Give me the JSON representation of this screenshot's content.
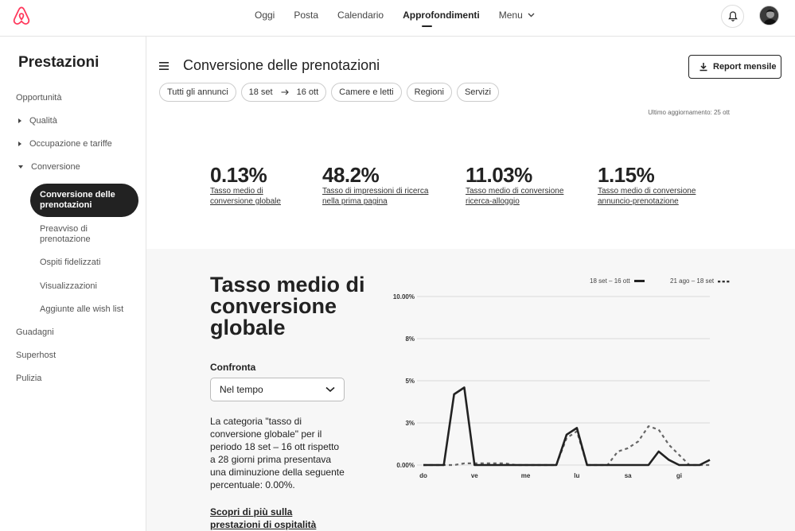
{
  "brand": {
    "accent": "#FF385C"
  },
  "topnav": {
    "items": [
      {
        "label": "Oggi"
      },
      {
        "label": "Posta"
      },
      {
        "label": "Calendario"
      },
      {
        "label": "Approfondimenti",
        "active": true
      },
      {
        "label": "Menu"
      }
    ]
  },
  "sidebar": {
    "title": "Prestazioni",
    "opportunita": "Opportunità",
    "qualita": "Qualità",
    "occupazione": "Occupazione e tariffe",
    "conversione": "Conversione",
    "sub": {
      "conv_prenotazioni": "Conversione delle prenotazioni",
      "preavviso": "Preavviso di prenotazione",
      "ospiti": "Ospiti fidelizzati",
      "visualizzazioni": "Visualizzazioni",
      "wishlist": "Aggiunte alle wish list"
    },
    "guadagni": "Guadagni",
    "superhost": "Superhost",
    "pulizia": "Pulizia"
  },
  "main": {
    "title": "Conversione delle prenotazioni",
    "report_button": "Report mensile",
    "filters": {
      "listings": "Tutti gli annunci",
      "date_from": "18 set",
      "date_to": "16 ott",
      "rooms": "Camere e letti",
      "regions": "Regioni",
      "services": "Servizi"
    },
    "updated": "Ultimo aggiornamento: 25 ott",
    "stats": [
      {
        "value": "0.13%",
        "label": "Tasso medio di conversione globale"
      },
      {
        "value": "48.2%",
        "label": "Tasso di impressioni di ricerca nella prima pagina"
      },
      {
        "value": "11.03%",
        "label": "Tasso medio di conversione ricerca-alloggio"
      },
      {
        "value": "1.15%",
        "label": "Tasso medio di conversione annuncio-prenotazione"
      }
    ]
  },
  "detail": {
    "title": "Tasso medio di conversione globale",
    "compare_label": "Confronta",
    "compare_value": "Nel tempo",
    "description": "La categoria \"tasso di conversione globale\" per il periodo 18 set – 16 ott rispetto a 28 giorni prima presentava una diminuzione della seguente percentuale: 0.00%.",
    "learn_more": "Scopri di più sulla prestazioni di ospitalità"
  },
  "chart_data": {
    "type": "line",
    "y_tick_labels": [
      "0.00%",
      "3%",
      "5%",
      "8%",
      "10.00%"
    ],
    "y_tick_values": [
      0,
      2.5,
      5,
      7.5,
      10
    ],
    "ylim": [
      0,
      10
    ],
    "x_tick_labels": [
      "do",
      "ve",
      "me",
      "lu",
      "sa",
      "gi"
    ],
    "x_tick_index": [
      0,
      5,
      10,
      15,
      20,
      25
    ],
    "grid": true,
    "legend_placement": "top-right",
    "series": [
      {
        "name": "18 set – 16 ott",
        "style": "solid",
        "color": "#222222",
        "values": [
          0,
          0,
          0,
          4.2,
          4.6,
          0,
          0,
          0,
          0,
          0,
          0,
          0,
          0,
          0,
          1.8,
          2.2,
          0,
          0,
          0,
          0,
          0,
          0,
          0,
          0.8,
          0.3,
          0,
          0,
          0,
          0.3
        ]
      },
      {
        "name": "21 ago – 18 set",
        "style": "dashed",
        "color": "#666666",
        "values": [
          0,
          0,
          0,
          0,
          0.1,
          0.1,
          0.1,
          0.1,
          0.1,
          0,
          0,
          0,
          0,
          0,
          1.6,
          2.0,
          0,
          0,
          0,
          0.8,
          1.0,
          1.4,
          2.3,
          2.1,
          1.2,
          0.6,
          0,
          0,
          0
        ]
      }
    ]
  }
}
